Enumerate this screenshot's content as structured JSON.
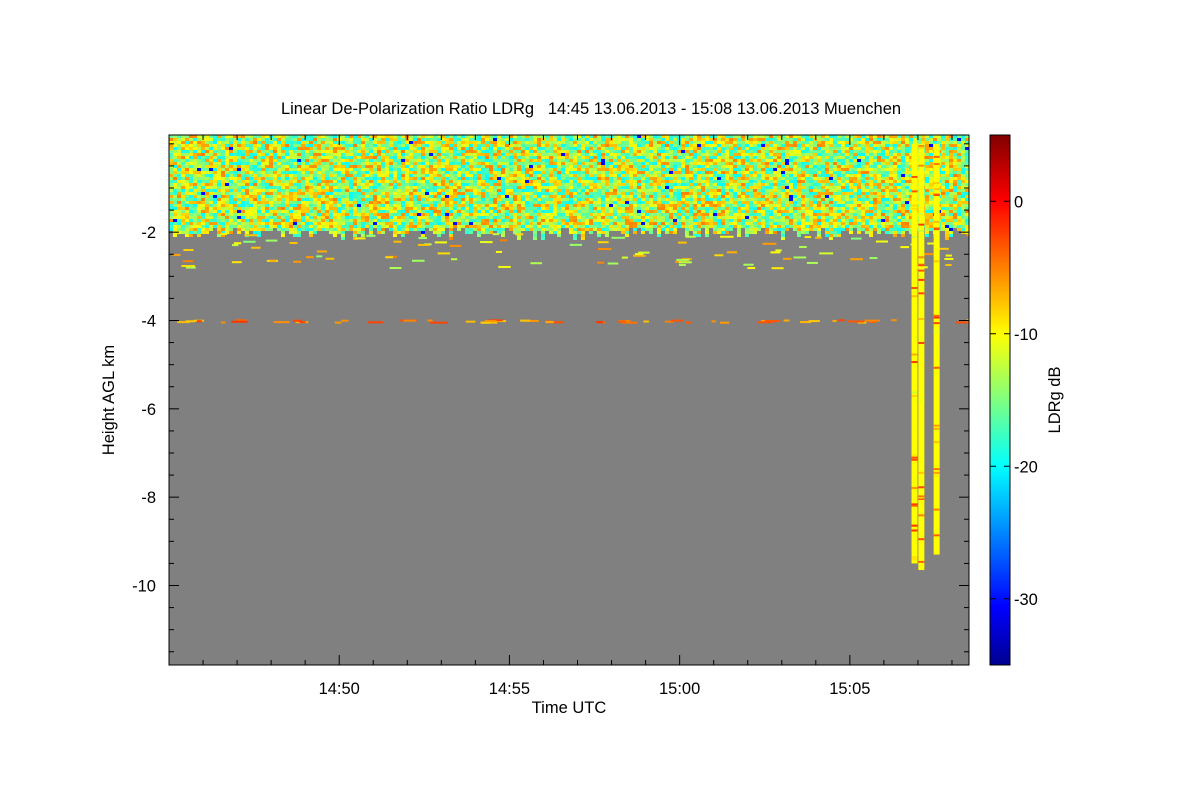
{
  "chart_data": {
    "type": "heatmap",
    "title": "Linear De-Polarization Ratio LDRg   14:45 13.06.2013 - 15:08 13.06.2013 Muenchen",
    "xlabel": "Time UTC",
    "ylabel": "Height AGL km",
    "x_range_min": [
      45.0,
      68.5
    ],
    "x_tick_values_min": [
      50,
      55,
      60,
      65
    ],
    "x_tick_labels": [
      "14:50",
      "14:55",
      "15:00",
      "15:05"
    ],
    "y_range_km": [
      -11.8,
      0.2
    ],
    "y_tick_values": [
      -2,
      -4,
      -6,
      -8,
      -10
    ],
    "y_tick_labels": [
      "-2",
      "-4",
      "-6",
      "-8",
      "-10"
    ],
    "colorbar": {
      "label": "LDRg dB",
      "range_db": [
        -35,
        5
      ],
      "tick_values": [
        0,
        -10,
        -20,
        -30
      ],
      "tick_labels": [
        "0",
        "-10",
        "-20",
        "-30"
      ],
      "colormap": [
        "#00008f",
        "#0000ff",
        "#00ffff",
        "#ffff00",
        "#ff0000",
        "#800000"
      ]
    },
    "no_signal_color": "#808080",
    "grid": false,
    "features": {
      "noisy_layer_km": [
        -2.0,
        0.2
      ],
      "noisy_layer_ldr_db_range": [
        -20,
        -5
      ],
      "layer_near_4km_height_km": -4.0,
      "layer_near_4km_ldr_db": -5,
      "fall_streaks": [
        {
          "time_min": 66.9,
          "top_km": 0.0,
          "bottom_km": -9.5,
          "ldr_db": -10
        },
        {
          "time_min": 67.1,
          "top_km": 0.0,
          "bottom_km": -9.65,
          "ldr_db": -10
        },
        {
          "time_min": 67.55,
          "top_km": 0.0,
          "bottom_km": -9.3,
          "ldr_db": -10
        }
      ]
    }
  }
}
